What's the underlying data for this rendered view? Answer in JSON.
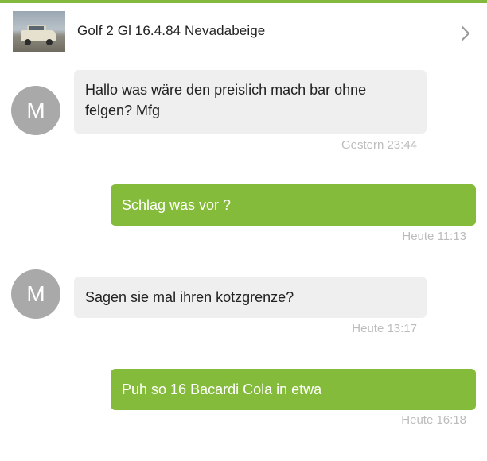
{
  "header": {
    "title": "Golf 2 Gl 16.4.84 Nevadabeige",
    "thumbnail_icon": "car-photo",
    "chevron_icon": "chevron-right-icon"
  },
  "colors": {
    "accent": "#84b940",
    "outgoing_bubble": "#85bb3a",
    "incoming_bubble": "#efefef",
    "avatar": "#a9a9a9",
    "timestamp": "#bcbcbc"
  },
  "messages": [
    {
      "direction": "incoming",
      "avatar": "M",
      "text": "Hallo was wäre den preislich mach bar ohne felgen? Mfg",
      "time": "Gestern 23:44"
    },
    {
      "direction": "outgoing",
      "text": "Schlag was vor ?",
      "time": "Heute 11:13"
    },
    {
      "direction": "incoming",
      "avatar": "M",
      "text": "Sagen sie mal ihren kotzgrenze?",
      "time": "Heute 13:17"
    },
    {
      "direction": "outgoing",
      "text": "Puh so 16 Bacardi Cola in etwa",
      "time": "Heute 16:18"
    }
  ]
}
